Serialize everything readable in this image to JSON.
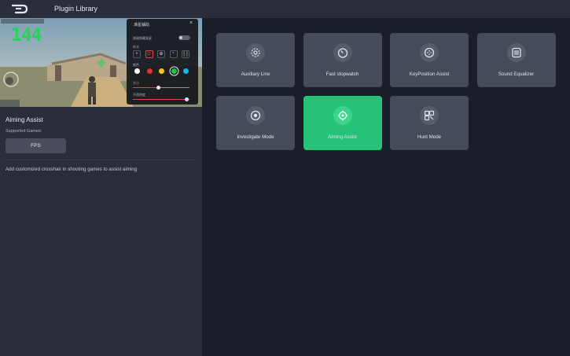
{
  "header": {
    "title": "Plugin Library"
  },
  "preview": {
    "counter": "144",
    "popup": {
      "title": "准星辅助",
      "close": "×",
      "toggle_label": "按键隐藏准星",
      "style_label": "样式",
      "styles": [
        "+",
        "⊙",
        "⊕",
        "⁺",
        "[·]"
      ],
      "color_label": "颜色",
      "colors": [
        "#ffffff",
        "#e0302a",
        "#f2c81d",
        "#22c447",
        "#19b6e6"
      ],
      "selected_color_index": 3,
      "size_label": "大小",
      "size_value": 0.45,
      "opacity_label": "不透明度",
      "opacity_value": 0.95
    }
  },
  "detail": {
    "name": "Aiming Assist",
    "supported_label": "Supported Games:",
    "game_tag": "FPS",
    "description": "Add customized crosshair in shooting games to assist aiming"
  },
  "plugins": [
    {
      "label": "Auxiliary Line",
      "icon": "auxiliary-line-icon",
      "active": false
    },
    {
      "label": "Fast stopwatch",
      "icon": "stopwatch-icon",
      "active": false
    },
    {
      "label": "KeyPosition Assist",
      "icon": "key-position-icon",
      "active": false
    },
    {
      "label": "Sound Equalizer",
      "icon": "equalizer-icon",
      "active": false
    },
    {
      "label": "Investigate Mode",
      "icon": "investigate-icon",
      "active": false
    },
    {
      "label": "Aiming Assist",
      "icon": "crosshair-icon",
      "active": true
    },
    {
      "label": "Hunt Mode",
      "icon": "hunt-mode-icon",
      "active": false
    }
  ],
  "colors": {
    "accent": "#26c277",
    "panel": "#2a2e3b",
    "card": "#464b5a",
    "background": "#1b1e29"
  }
}
